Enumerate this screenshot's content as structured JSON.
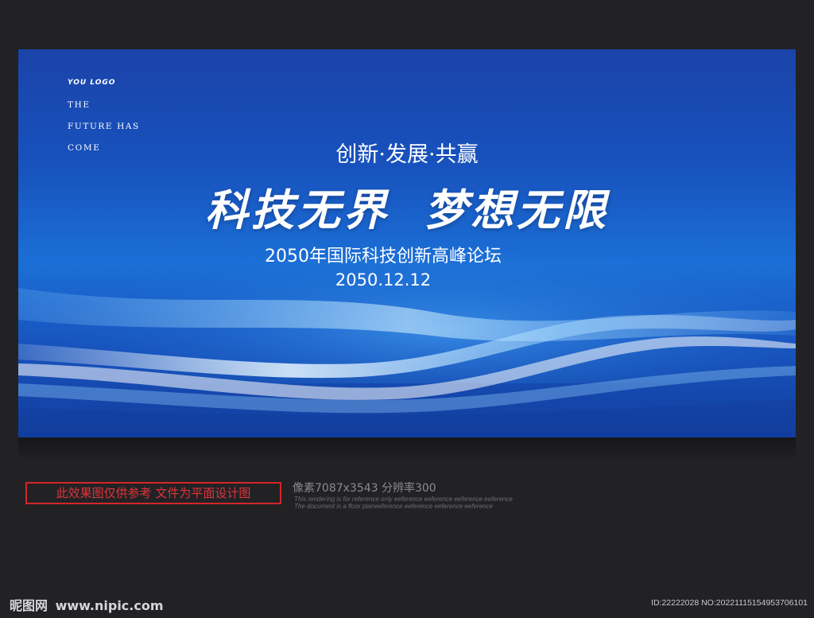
{
  "banner": {
    "logo": "YOU LOGO",
    "tagline": [
      "THE",
      "FUTURE HAS",
      "COME"
    ],
    "slogan": "创新·发展·共赢",
    "headline_left": "科技无界",
    "headline_right": "梦想无限",
    "forum": "2050年国际科技创新高峰论坛",
    "date": "2050.12.12",
    "colors": {
      "deep_blue": "#123d9e",
      "mid_blue": "#1b6fd6",
      "highlight": "#ffffff"
    }
  },
  "footer": {
    "notice": "此效果图仅供参考 文件为平面设计图",
    "specs": "像素7087x3543 分辨率300",
    "fine_print": [
      "This rendering is for reference only  eeference eeference eeference eeference",
      "The document is a floor planeeference eeference eeference eeference"
    ],
    "brand_name": "昵图网",
    "brand_url": "www.nipic.com",
    "image_id": "ID:22222028 NO:20221115154953706101",
    "notice_color": "#d3262a"
  }
}
